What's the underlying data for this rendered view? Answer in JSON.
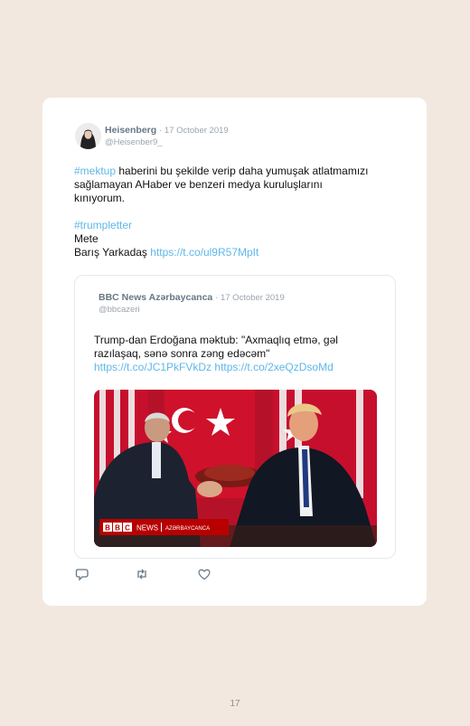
{
  "tweet": {
    "author_name": "Heisenberg",
    "date": "· 17 October 2019",
    "handle": "@Heisenber9_",
    "hashtag1": "#mektup",
    "text1": " haberini bu şekilde verip daha yumuşak atlatmamızı sağlamayan AHaber ve benzeri medya kuruluşlarını kınıyorum.",
    "hashtag2": "#trumpletter",
    "line_mete": "Mete",
    "line_baris": "Barış Yarkadaş ",
    "link1": "https://t.co/ul9R57MpIt"
  },
  "quote": {
    "author_name": "BBC News Azərbaycanca",
    "date": "· 17 October 2019",
    "handle": "@bbcazeri",
    "text": "Trump-dan Erdoğana məktub: \"Axmaqlıq etmə, gəl razılaşaq, sənə sonra zəng edəcəm\"",
    "link1": "https://t.co/JC1PkFVkDz",
    "link2": "https://t.co/2xeQzDsoMd",
    "image_brand": "BBC",
    "image_news": "NEWS",
    "image_lang": "AZƏRBAYCANCA"
  },
  "actions": {
    "reply_icon": "reply-icon",
    "retweet_icon": "retweet-icon",
    "like_icon": "heart-icon"
  },
  "page_number": "17"
}
